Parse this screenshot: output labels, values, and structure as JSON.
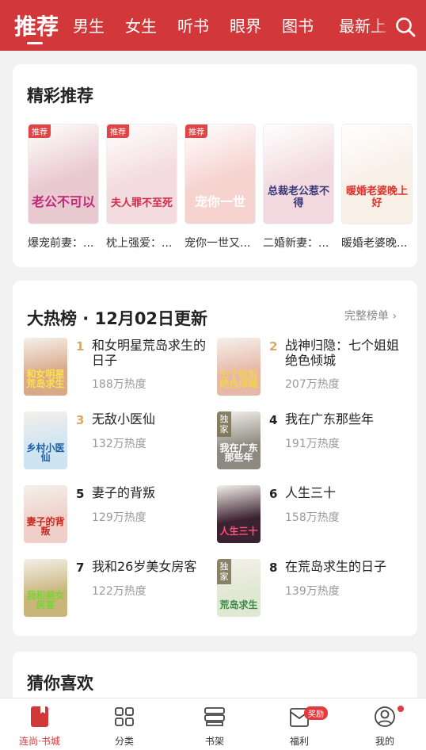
{
  "header": {
    "tabs": [
      {
        "label": "推荐",
        "active": true
      },
      {
        "label": "男生"
      },
      {
        "label": "女生"
      },
      {
        "label": "听书"
      },
      {
        "label": "眼界"
      },
      {
        "label": "图书"
      },
      {
        "label": "最新上"
      }
    ],
    "search_icon": "search-icon"
  },
  "featured": {
    "title": "精彩推荐",
    "badge": "推荐",
    "books": [
      {
        "name": "爆宠前妻：...",
        "badge": true,
        "cover_text": "老公不可以",
        "cover_color": "#e9c9d0",
        "text_color": "#c0287a"
      },
      {
        "name": "枕上强爱：...",
        "badge": true,
        "cover_text": "夫人罪不至死",
        "cover_color": "#f3dbe0",
        "text_color": "#d12a4a"
      },
      {
        "name": "宠你一世又...",
        "badge": true,
        "cover_text": "宠你一世",
        "cover_color": "#f6d3cf",
        "text_color": "#ffffff"
      },
      {
        "name": "二婚新妻：...",
        "badge": false,
        "cover_text": "总裁老公惹不得",
        "cover_color": "#f2d9df",
        "text_color": "#3a3a7a"
      },
      {
        "name": "暖婚老婆晚...",
        "badge": false,
        "cover_text": "暖婚老婆晚上好",
        "cover_color": "#f8efe6",
        "text_color": "#d8342f"
      }
    ]
  },
  "ranking": {
    "title": "大热榜 · 12月02日更新",
    "more": "完整榜单 ›",
    "exclusive": "独家",
    "items": [
      {
        "rank": "1",
        "title": "和女明星荒岛求生的日子",
        "heat": "188万热度",
        "cover_color": "#d9a98a",
        "cover_text": "和女明星荒岛求生",
        "text_color": "#ffe14a",
        "exclusive": false
      },
      {
        "rank": "2",
        "title": "战神归隐：七个姐姐绝色倾城",
        "heat": "207万热度",
        "cover_color": "#e6b8a8",
        "cover_text": "七个姐姐绝色倾城",
        "text_color": "#f5d24b",
        "exclusive": false
      },
      {
        "rank": "3",
        "title": "无敌小医仙",
        "heat": "132万热度",
        "cover_color": "#cfe4f2",
        "cover_text": "乡村小医仙",
        "text_color": "#1b5ea8",
        "exclusive": false
      },
      {
        "rank": "4",
        "title": "我在广东那些年",
        "heat": "191万热度",
        "cover_color": "#8c8a80",
        "cover_text": "我在广东那些年",
        "text_color": "#ffffff",
        "exclusive": true
      },
      {
        "rank": "5",
        "title": "妻子的背叛",
        "heat": "129万热度",
        "cover_color": "#efcfc8",
        "cover_text": "妻子的背叛",
        "text_color": "#c6281f",
        "exclusive": false
      },
      {
        "rank": "6",
        "title": "人生三十",
        "heat": "158万热度",
        "cover_color": "#3b2230",
        "cover_text": "人生三十",
        "text_color": "#ff4f7a",
        "exclusive": false
      },
      {
        "rank": "7",
        "title": "我和26岁美女房客",
        "heat": "122万热度",
        "cover_color": "#c9b57a",
        "cover_text": "我和美女房客",
        "text_color": "#7bd23a",
        "exclusive": false
      },
      {
        "rank": "8",
        "title": "在荒岛求生的日子",
        "heat": "139万热度",
        "cover_color": "#dfe8d2",
        "cover_text": "荒岛求生",
        "text_color": "#3a8a4a",
        "exclusive": true
      }
    ]
  },
  "guess": {
    "title": "猜你喜欢"
  },
  "bottom_nav": [
    {
      "label": "连尚·书城",
      "icon": "book-icon",
      "active": true
    },
    {
      "label": "分类",
      "icon": "grid-icon"
    },
    {
      "label": "书架",
      "icon": "bookshelf-icon"
    },
    {
      "label": "福利",
      "icon": "gift-envelope-icon",
      "badge": "奖励"
    },
    {
      "label": "我的",
      "icon": "user-icon",
      "dot": true
    }
  ],
  "colors": {
    "brand": "#d2383a",
    "rank_top": "#d9a86b"
  }
}
